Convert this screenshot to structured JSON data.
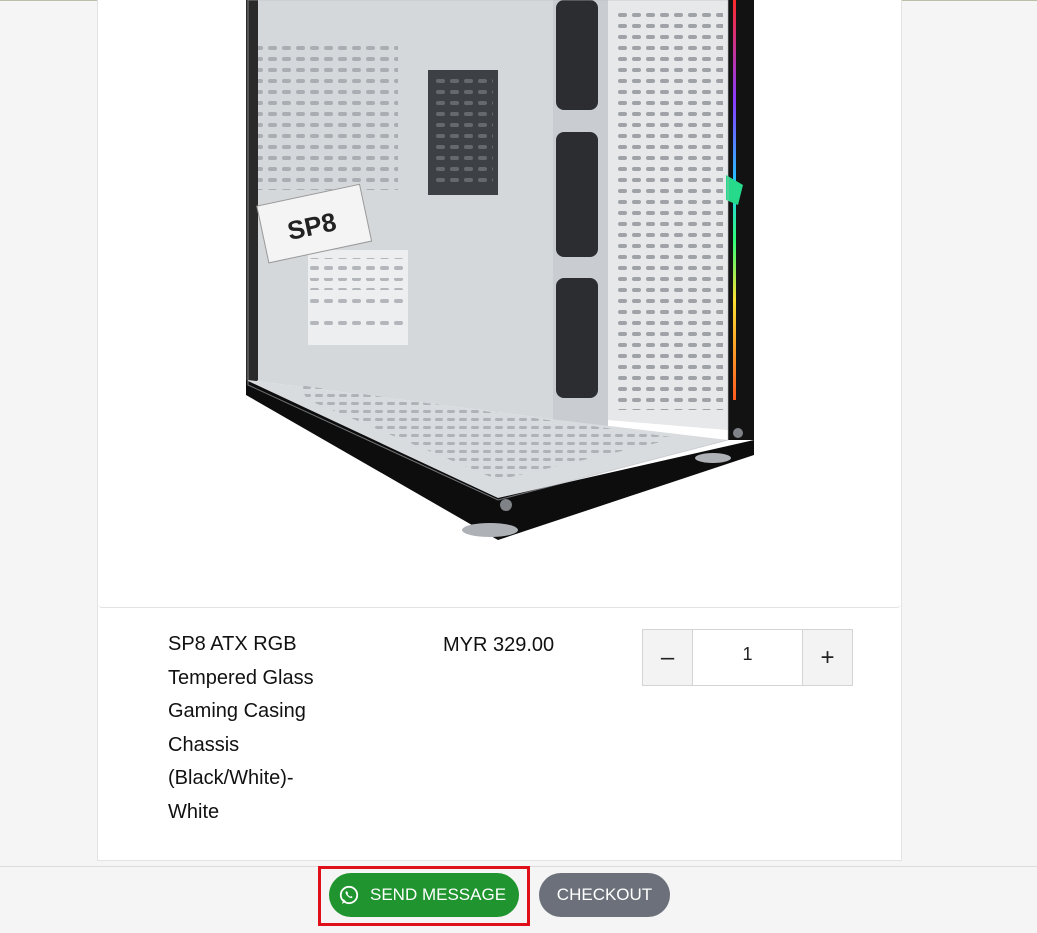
{
  "product": {
    "name_lines": [
      "SP8 ATX RGB",
      "Tempered Glass",
      "Gaming Casing",
      "Chassis",
      "(Black/White)-",
      "White"
    ],
    "price": "MYR 329.00",
    "image_label": "SP8",
    "quantity": "1"
  },
  "stepper": {
    "minus_label": "–",
    "plus_label": "+"
  },
  "actions": {
    "send_label": "SEND MESSAGE",
    "checkout_label": "CHECKOUT"
  },
  "icons": {
    "send": "whatsapp-icon"
  },
  "colors": {
    "send_button": "#20942f",
    "checkout_button": "#6b707a",
    "highlight_border": "#e0101b",
    "case_frame": "#111111",
    "case_panel": "#dfe1e3",
    "rgb_strip": "#7b3bff"
  }
}
